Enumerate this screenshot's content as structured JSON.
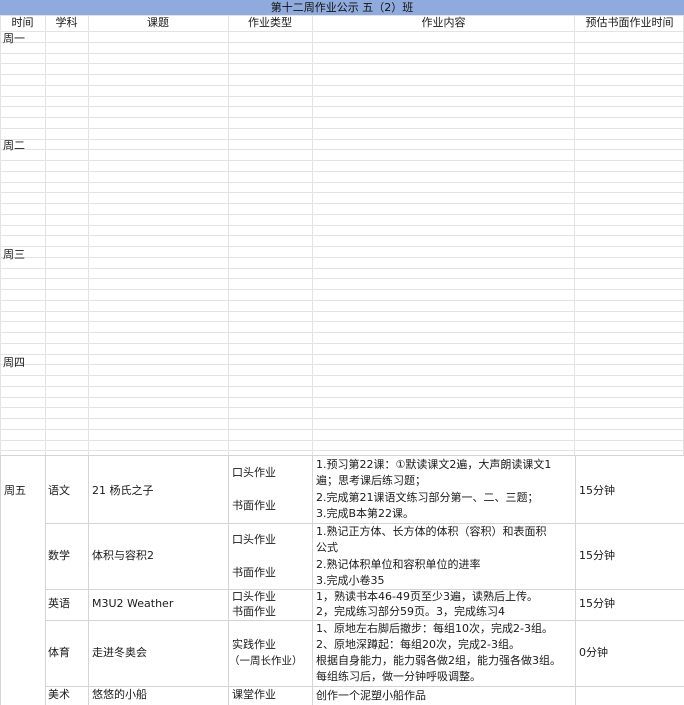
{
  "title": "第十二周作业公示 五（2）班",
  "headers": {
    "time": "时间",
    "subject": "学科",
    "topic": "课题",
    "type": "作业类型",
    "content": "作业内容",
    "estimate": "预估书面作业时间"
  },
  "days": {
    "mon": "周一",
    "tue": "周二",
    "wed": "周三",
    "thu": "周四",
    "fri": "周五"
  },
  "rows": {
    "chinese": {
      "subject": "语文",
      "topic": "21 杨氏之子",
      "type_oral": "口头作业",
      "type_written": "书面作业",
      "content": [
        "1.预习第22课：①默读课文2遍，大声朗读课文1",
        "遍；思考课后练习题；",
        "2.完成第21课语文练习部分第一、二、三题；",
        "3.完成B本第22课。"
      ],
      "time": "15分钟"
    },
    "math": {
      "subject": "数学",
      "topic": "体积与容积2",
      "type_oral": "口头作业",
      "type_written": "书面作业",
      "content": [
        "1.熟记正方体、长方体的体积（容积）和表面积",
        "公式",
        "2.熟记体积单位和容积单位的进率",
        "3.完成小卷35"
      ],
      "time": "15分钟"
    },
    "english": {
      "subject": "英语",
      "topic": "M3U2 Weather",
      "type_oral": "口头作业",
      "type_written": "书面作业",
      "content": [
        "1，熟读书本46-49页至少3遍，读熟后上传。",
        "2，完成练习部分59页。3，完成练习4"
      ],
      "time": "15分钟"
    },
    "pe": {
      "subject": "体育",
      "topic": "走进冬奥会",
      "type_line1": "实践作业",
      "type_line2": "（一周长作业）",
      "content": [
        "1、原地左右脚后撤步：每组10次，完成2-3组。",
        "2、原地深蹲起：每组20次，完成2-3组。",
        "根据自身能力，能力弱各做2组，能力强各做3组。",
        "每组练习后，做一分钟呼吸调整。"
      ],
      "time": "0分钟"
    },
    "art": {
      "subject": "美术",
      "topic": "悠悠的小船",
      "type": "课堂作业",
      "content": "创作一个泥塑小船作品"
    }
  }
}
